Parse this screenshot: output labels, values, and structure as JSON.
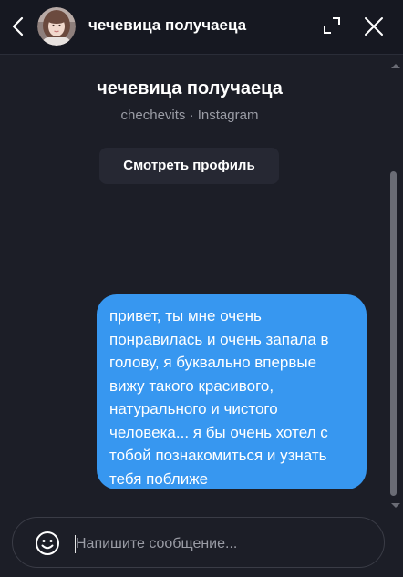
{
  "header": {
    "name": "чечевица получаеца",
    "back_icon": "chevron-left-icon",
    "expand_icon": "expand-icon",
    "close_icon": "close-icon"
  },
  "profile": {
    "name": "чечевица получаеца",
    "subtitle": "chechevits · Instagram",
    "view_profile_label": "Смотреть профиль"
  },
  "messages": [
    {
      "direction": "outgoing",
      "lines": [
        "привет, ты мне очень",
        "понравилась и очень запала в",
        "голову, я буквально впервые",
        "вижу такого красивого,",
        "натурального и чистого",
        "человека... я бы очень хотел с",
        "тобой познакомиться и узнать",
        "тебя поближе"
      ]
    }
  ],
  "composer": {
    "placeholder": "Напишите сообщение...",
    "value": "",
    "emoji_icon": "smiley-icon"
  },
  "colors": {
    "background": "#1c1e27",
    "header_background": "#161821",
    "bubble": "#3797f0",
    "button_background": "#262833",
    "muted_text": "#9a9ca5"
  }
}
